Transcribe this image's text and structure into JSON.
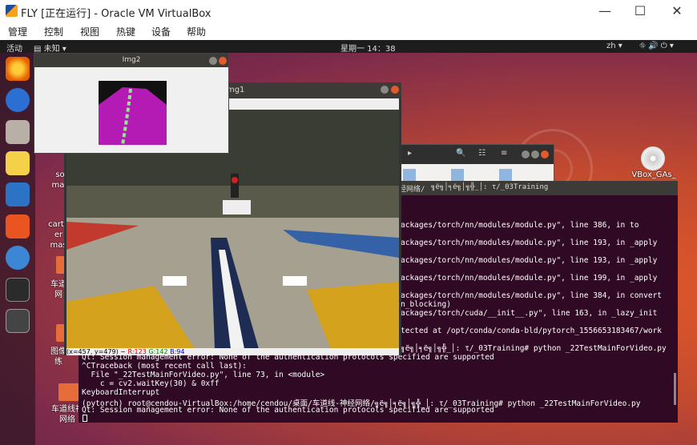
{
  "window": {
    "title": "FLY [正在运行] - Oracle VM VirtualBox",
    "minimize": "—",
    "maximize": "☐",
    "close": "✕"
  },
  "menu": [
    "管理",
    "控制",
    "视图",
    "热键",
    "设备",
    "帮助"
  ],
  "topbar": {
    "activities": "活动",
    "app": "▤ 未知 ▾",
    "clock": "星期一 14：38",
    "lang": "zh ▾",
    "tray": "⛗ 🔊 ⏻ ▾"
  },
  "dock_labels": {
    "sc": "so\nmas",
    "cart": "carto\ner\nmas",
    "lane": "车道\n网",
    "img": "图像\n练",
    "lane2": "车道线神\n网络"
  },
  "desktop_icons": {
    "vbox": "VBox_GAs_"
  },
  "files": {
    "icons": [
      "⏮",
      "▸",
      "🔍",
      "☷",
      "≡"
    ]
  },
  "terminal": {
    "title": "╗ё╗│╕ё╗│╗╬_│: τ/_03Training",
    "head_prefix": "经网络/",
    "lines": [
      "ackages/torch/nn/modules/module.py\", line 386, in to",
      "ackages/torch/nn/modules/module.py\", line 193, in _apply",
      "ackages/torch/nn/modules/module.py\", line 193, in _apply",
      "ackages/torch/nn/modules/module.py\", line 199, in _apply",
      "ackages/torch/nn/modules/module.py\", line 384, in convert",
      "n_blocking)",
      "ackages/torch/cuda/__init__.py\", line 163, in _lazy_init",
      "",
      "tected at /opt/conda/conda-bld/pytorch_1556653183467/work",
      "",
      "╗ё╗│╕ё╗│╗╬_│: τ/_03Training# python _22TestMainForVideo.py"
    ],
    "full_lines": [
      "Qt: Session management error: None of the authentication protocols specified are supported",
      "^CTraceback (most recent call last):",
      "  File \"_22TestMainForVideo.py\", line 73, in <module>",
      "    c = cv2.waitKey(30) & 0xff",
      "KeyboardInterrupt",
      "(pytorch) root@cendou-VirtualBox:/home/cendou/桌面/车道线-神经网络/╗ё╗│╕ё╗│╗╬_│: τ/_03Training# python _22TestMainForVideo.py",
      "Qt: Session management error: None of the authentication protocols specified are supported"
    ]
  },
  "img1": {
    "title": "Img1",
    "status_xy": "(x=457, y=479) ~",
    "r": "R:123",
    "g": "G:142",
    "b": "B:94"
  },
  "img2": {
    "title": "Img2"
  },
  "colors": {
    "accent": "#e95420",
    "terminal_bg": "#300a24"
  }
}
